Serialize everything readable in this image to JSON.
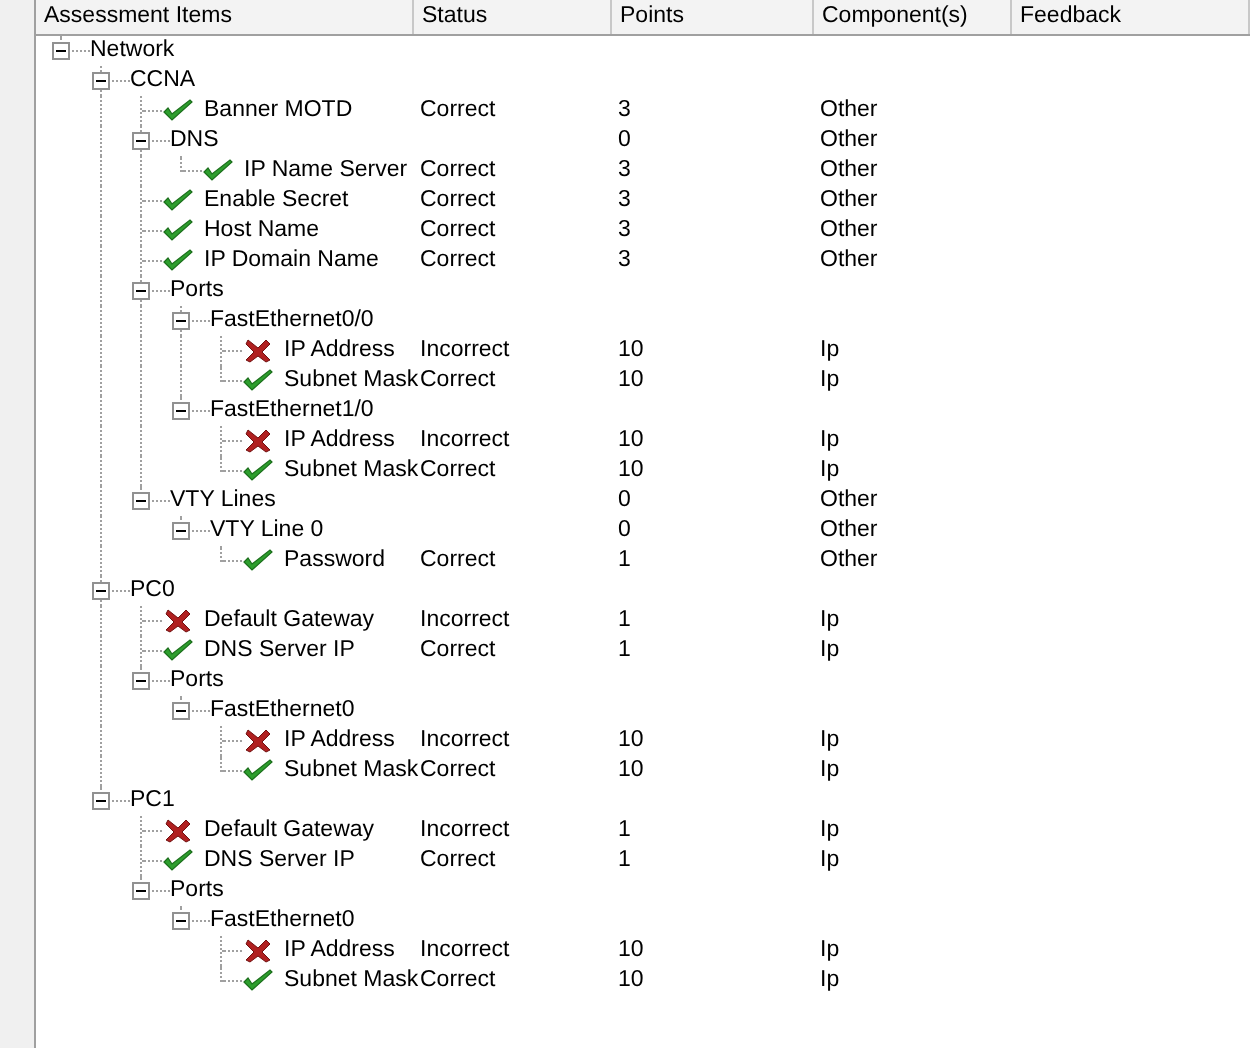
{
  "columns": [
    "Assessment Items",
    "Status",
    "Points",
    "Component(s)",
    "Feedback"
  ],
  "tree": [
    {
      "label": "Network",
      "kind": "group",
      "expanded": true,
      "children": [
        {
          "label": "CCNA",
          "kind": "group",
          "expanded": true,
          "children": [
            {
              "label": "Banner MOTD",
              "kind": "pass",
              "status": "Correct",
              "points": "3",
              "component": "Other"
            },
            {
              "label": "DNS",
              "kind": "group",
              "expanded": true,
              "points": "0",
              "component": "Other",
              "children": [
                {
                  "label": "IP Name Server",
                  "kind": "pass",
                  "status": "Correct",
                  "points": "3",
                  "component": "Other"
                }
              ]
            },
            {
              "label": "Enable Secret",
              "kind": "pass",
              "status": "Correct",
              "points": "3",
              "component": "Other"
            },
            {
              "label": "Host Name",
              "kind": "pass",
              "status": "Correct",
              "points": "3",
              "component": "Other"
            },
            {
              "label": "IP Domain Name",
              "kind": "pass",
              "status": "Correct",
              "points": "3",
              "component": "Other"
            },
            {
              "label": "Ports",
              "kind": "group",
              "expanded": true,
              "children": [
                {
                  "label": "FastEthernet0/0",
                  "kind": "group",
                  "expanded": true,
                  "children": [
                    {
                      "label": "IP Address",
                      "kind": "fail",
                      "status": "Incorrect",
                      "points": "10",
                      "component": "Ip"
                    },
                    {
                      "label": "Subnet Mask",
                      "kind": "pass",
                      "status": "Correct",
                      "points": "10",
                      "component": "Ip"
                    }
                  ]
                },
                {
                  "label": "FastEthernet1/0",
                  "kind": "group",
                  "expanded": true,
                  "children": [
                    {
                      "label": "IP Address",
                      "kind": "fail",
                      "status": "Incorrect",
                      "points": "10",
                      "component": "Ip"
                    },
                    {
                      "label": "Subnet Mask",
                      "kind": "pass",
                      "status": "Correct",
                      "points": "10",
                      "component": "Ip"
                    }
                  ]
                }
              ]
            },
            {
              "label": "VTY Lines",
              "kind": "group",
              "expanded": true,
              "points": "0",
              "component": "Other",
              "children": [
                {
                  "label": "VTY Line 0",
                  "kind": "group",
                  "expanded": true,
                  "points": "0",
                  "component": "Other",
                  "children": [
                    {
                      "label": "Password",
                      "kind": "pass",
                      "status": "Correct",
                      "points": "1",
                      "component": "Other"
                    }
                  ]
                }
              ]
            }
          ]
        },
        {
          "label": "PC0",
          "kind": "group",
          "expanded": true,
          "children": [
            {
              "label": "Default Gateway",
              "kind": "fail",
              "status": "Incorrect",
              "points": "1",
              "component": "Ip"
            },
            {
              "label": "DNS Server IP",
              "kind": "pass",
              "status": "Correct",
              "points": "1",
              "component": "Ip"
            },
            {
              "label": "Ports",
              "kind": "group",
              "expanded": true,
              "children": [
                {
                  "label": "FastEthernet0",
                  "kind": "group",
                  "expanded": true,
                  "children": [
                    {
                      "label": "IP Address",
                      "kind": "fail",
                      "status": "Incorrect",
                      "points": "10",
                      "component": "Ip"
                    },
                    {
                      "label": "Subnet Mask",
                      "kind": "pass",
                      "status": "Correct",
                      "points": "10",
                      "component": "Ip"
                    }
                  ]
                }
              ]
            }
          ]
        },
        {
          "label": "PC1",
          "kind": "group",
          "expanded": true,
          "children": [
            {
              "label": "Default Gateway",
              "kind": "fail",
              "status": "Incorrect",
              "points": "1",
              "component": "Ip"
            },
            {
              "label": "DNS Server IP",
              "kind": "pass",
              "status": "Correct",
              "points": "1",
              "component": "Ip"
            },
            {
              "label": "Ports",
              "kind": "group",
              "expanded": true,
              "children": [
                {
                  "label": "FastEthernet0",
                  "kind": "group",
                  "expanded": true,
                  "children": [
                    {
                      "label": "IP Address",
                      "kind": "fail",
                      "status": "Incorrect",
                      "points": "10",
                      "component": "Ip"
                    },
                    {
                      "label": "Subnet Mask",
                      "kind": "pass",
                      "status": "Correct",
                      "points": "10",
                      "component": "Ip"
                    }
                  ]
                }
              ]
            }
          ]
        }
      ]
    }
  ]
}
